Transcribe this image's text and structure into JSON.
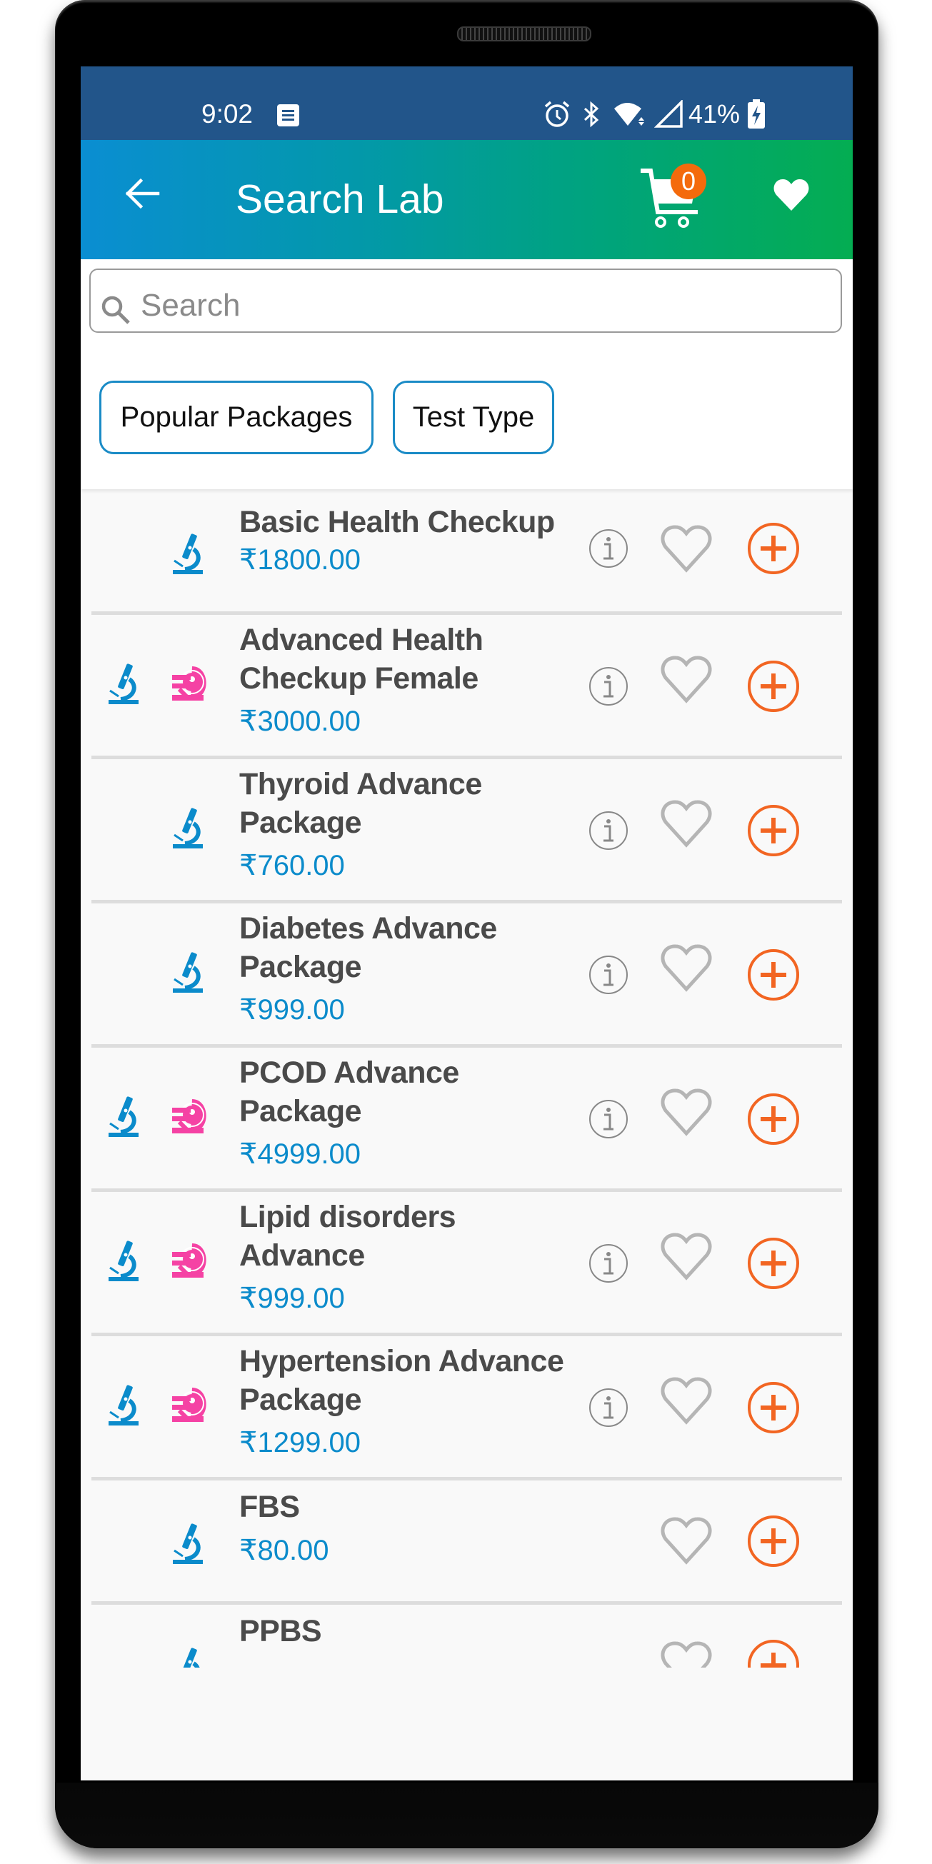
{
  "status_bar": {
    "time": "9:02",
    "battery_percent": "41%",
    "icons": [
      "notes-icon",
      "alarm-icon",
      "bluetooth-icon",
      "wifi-icon",
      "signal-icon",
      "battery-charging-icon"
    ]
  },
  "app_bar": {
    "title": "Search Lab",
    "back_icon": "arrow-left-icon",
    "cart_icon": "cart-icon",
    "cart_count": "0",
    "favorites_icon": "heart-icon"
  },
  "search": {
    "placeholder": "Search",
    "value": ""
  },
  "filters": [
    {
      "label": "Popular Packages"
    },
    {
      "label": "Test Type"
    }
  ],
  "colors": {
    "status_bar": "#22558a",
    "header_gradient_start": "#0a8ed2",
    "header_gradient_end": "#04ad52",
    "accent_orange": "#f26522",
    "price_blue": "#0b8bcb",
    "pathology_icon_blue": "#0b8bcb",
    "radiology_icon_pink": "#f542a4"
  },
  "items": [
    {
      "name": "Basic Health Checkup",
      "price": "₹1800.00",
      "types": [
        "pathology"
      ],
      "has_info": true
    },
    {
      "name": "Advanced Health Checkup Female",
      "price": "₹3000.00",
      "types": [
        "pathology",
        "radiology"
      ],
      "has_info": true
    },
    {
      "name": "Thyroid Advance Package",
      "price": "₹760.00",
      "types": [
        "pathology"
      ],
      "has_info": true
    },
    {
      "name": "Diabetes Advance Package",
      "price": "₹999.00",
      "types": [
        "pathology"
      ],
      "has_info": true
    },
    {
      "name": "PCOD Advance Package",
      "price": "₹4999.00",
      "types": [
        "pathology",
        "radiology"
      ],
      "has_info": true
    },
    {
      "name": "Lipid disorders Advance",
      "price": "₹999.00",
      "types": [
        "pathology",
        "radiology"
      ],
      "has_info": true
    },
    {
      "name": "Hypertension Advance Package",
      "price": "₹1299.00",
      "types": [
        "pathology",
        "radiology"
      ],
      "has_info": true
    },
    {
      "name": "FBS",
      "price": "₹80.00",
      "types": [
        "pathology"
      ],
      "has_info": false
    },
    {
      "name": "PPBS",
      "price": "",
      "types": [
        "pathology"
      ],
      "has_info": false
    }
  ]
}
